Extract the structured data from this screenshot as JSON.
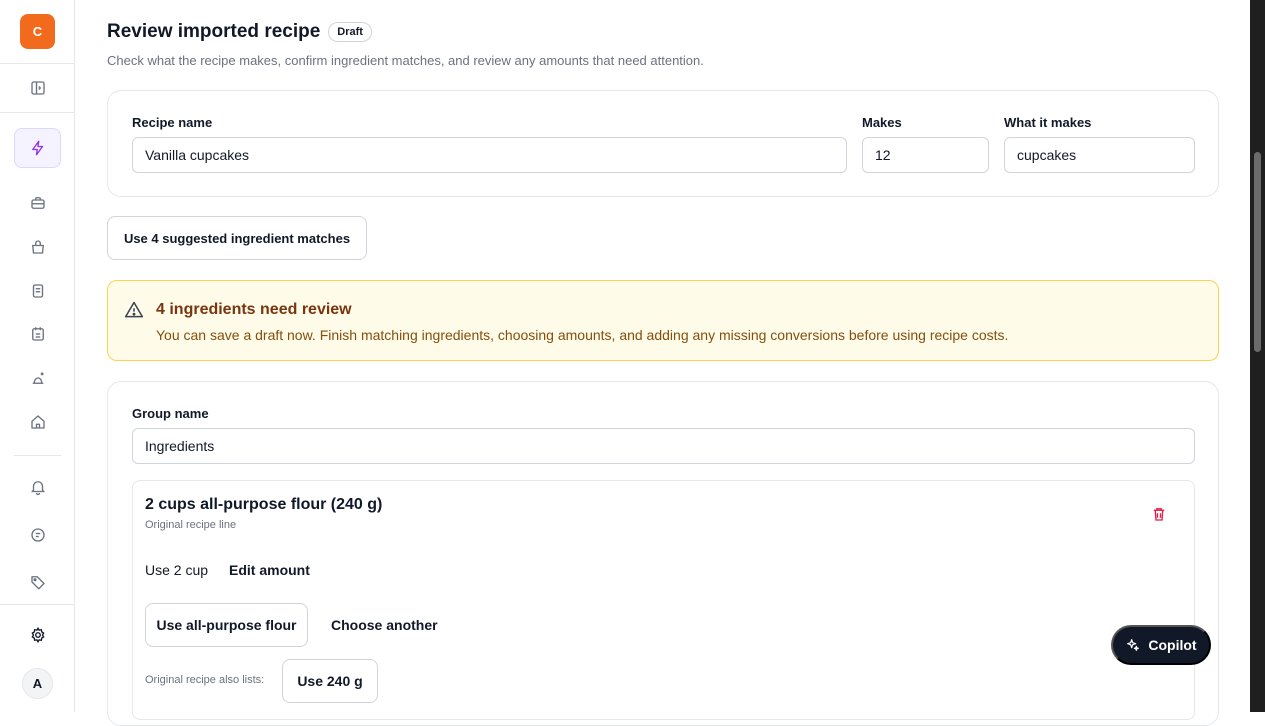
{
  "sidebar": {
    "logo_letter": "C",
    "avatar_letter": "A",
    "icons": [
      "sidebar-toggle-icon",
      "bolt-icon",
      "briefcase-icon",
      "shopping-bag-icon",
      "receipt-icon",
      "calendar-list-icon",
      "chef-icon",
      "home-icon",
      "bell-icon",
      "chat-icon",
      "tag-icon",
      "gear-icon"
    ]
  },
  "header": {
    "title": "Review imported recipe",
    "badge": "Draft",
    "subtitle": "Check what the recipe makes, confirm ingredient matches, and review any amounts that need attention."
  },
  "recipe": {
    "name_label": "Recipe name",
    "name_value": "Vanilla cupcakes",
    "makes_label": "Makes",
    "makes_value": "12",
    "what_label": "What it makes",
    "what_value": "cupcakes"
  },
  "suggest_button": "Use 4 suggested ingredient matches",
  "alert": {
    "title": "4 ingredients need review",
    "body": "You can save a draft now. Finish matching ingredients, choosing amounts, and adding any missing conversions before using recipe costs."
  },
  "group": {
    "label": "Group name",
    "value": "Ingredients",
    "ingredient": {
      "title": "2 cups all-purpose flour (240 g)",
      "subtitle": "Original recipe line",
      "use_amount": "Use 2 cup",
      "edit_amount": "Edit amount",
      "use_match": "Use all-purpose flour",
      "choose_another": "Choose another",
      "also_lists": "Original recipe also lists:",
      "use_alt": "Use 240 g"
    }
  },
  "copilot_label": "Copilot",
  "colors": {
    "brand": "#f26a1b",
    "accent_purple": "#9333ea",
    "alert_bg": "#fefce8",
    "alert_border": "#fcd34d",
    "danger": "#e11d48"
  }
}
